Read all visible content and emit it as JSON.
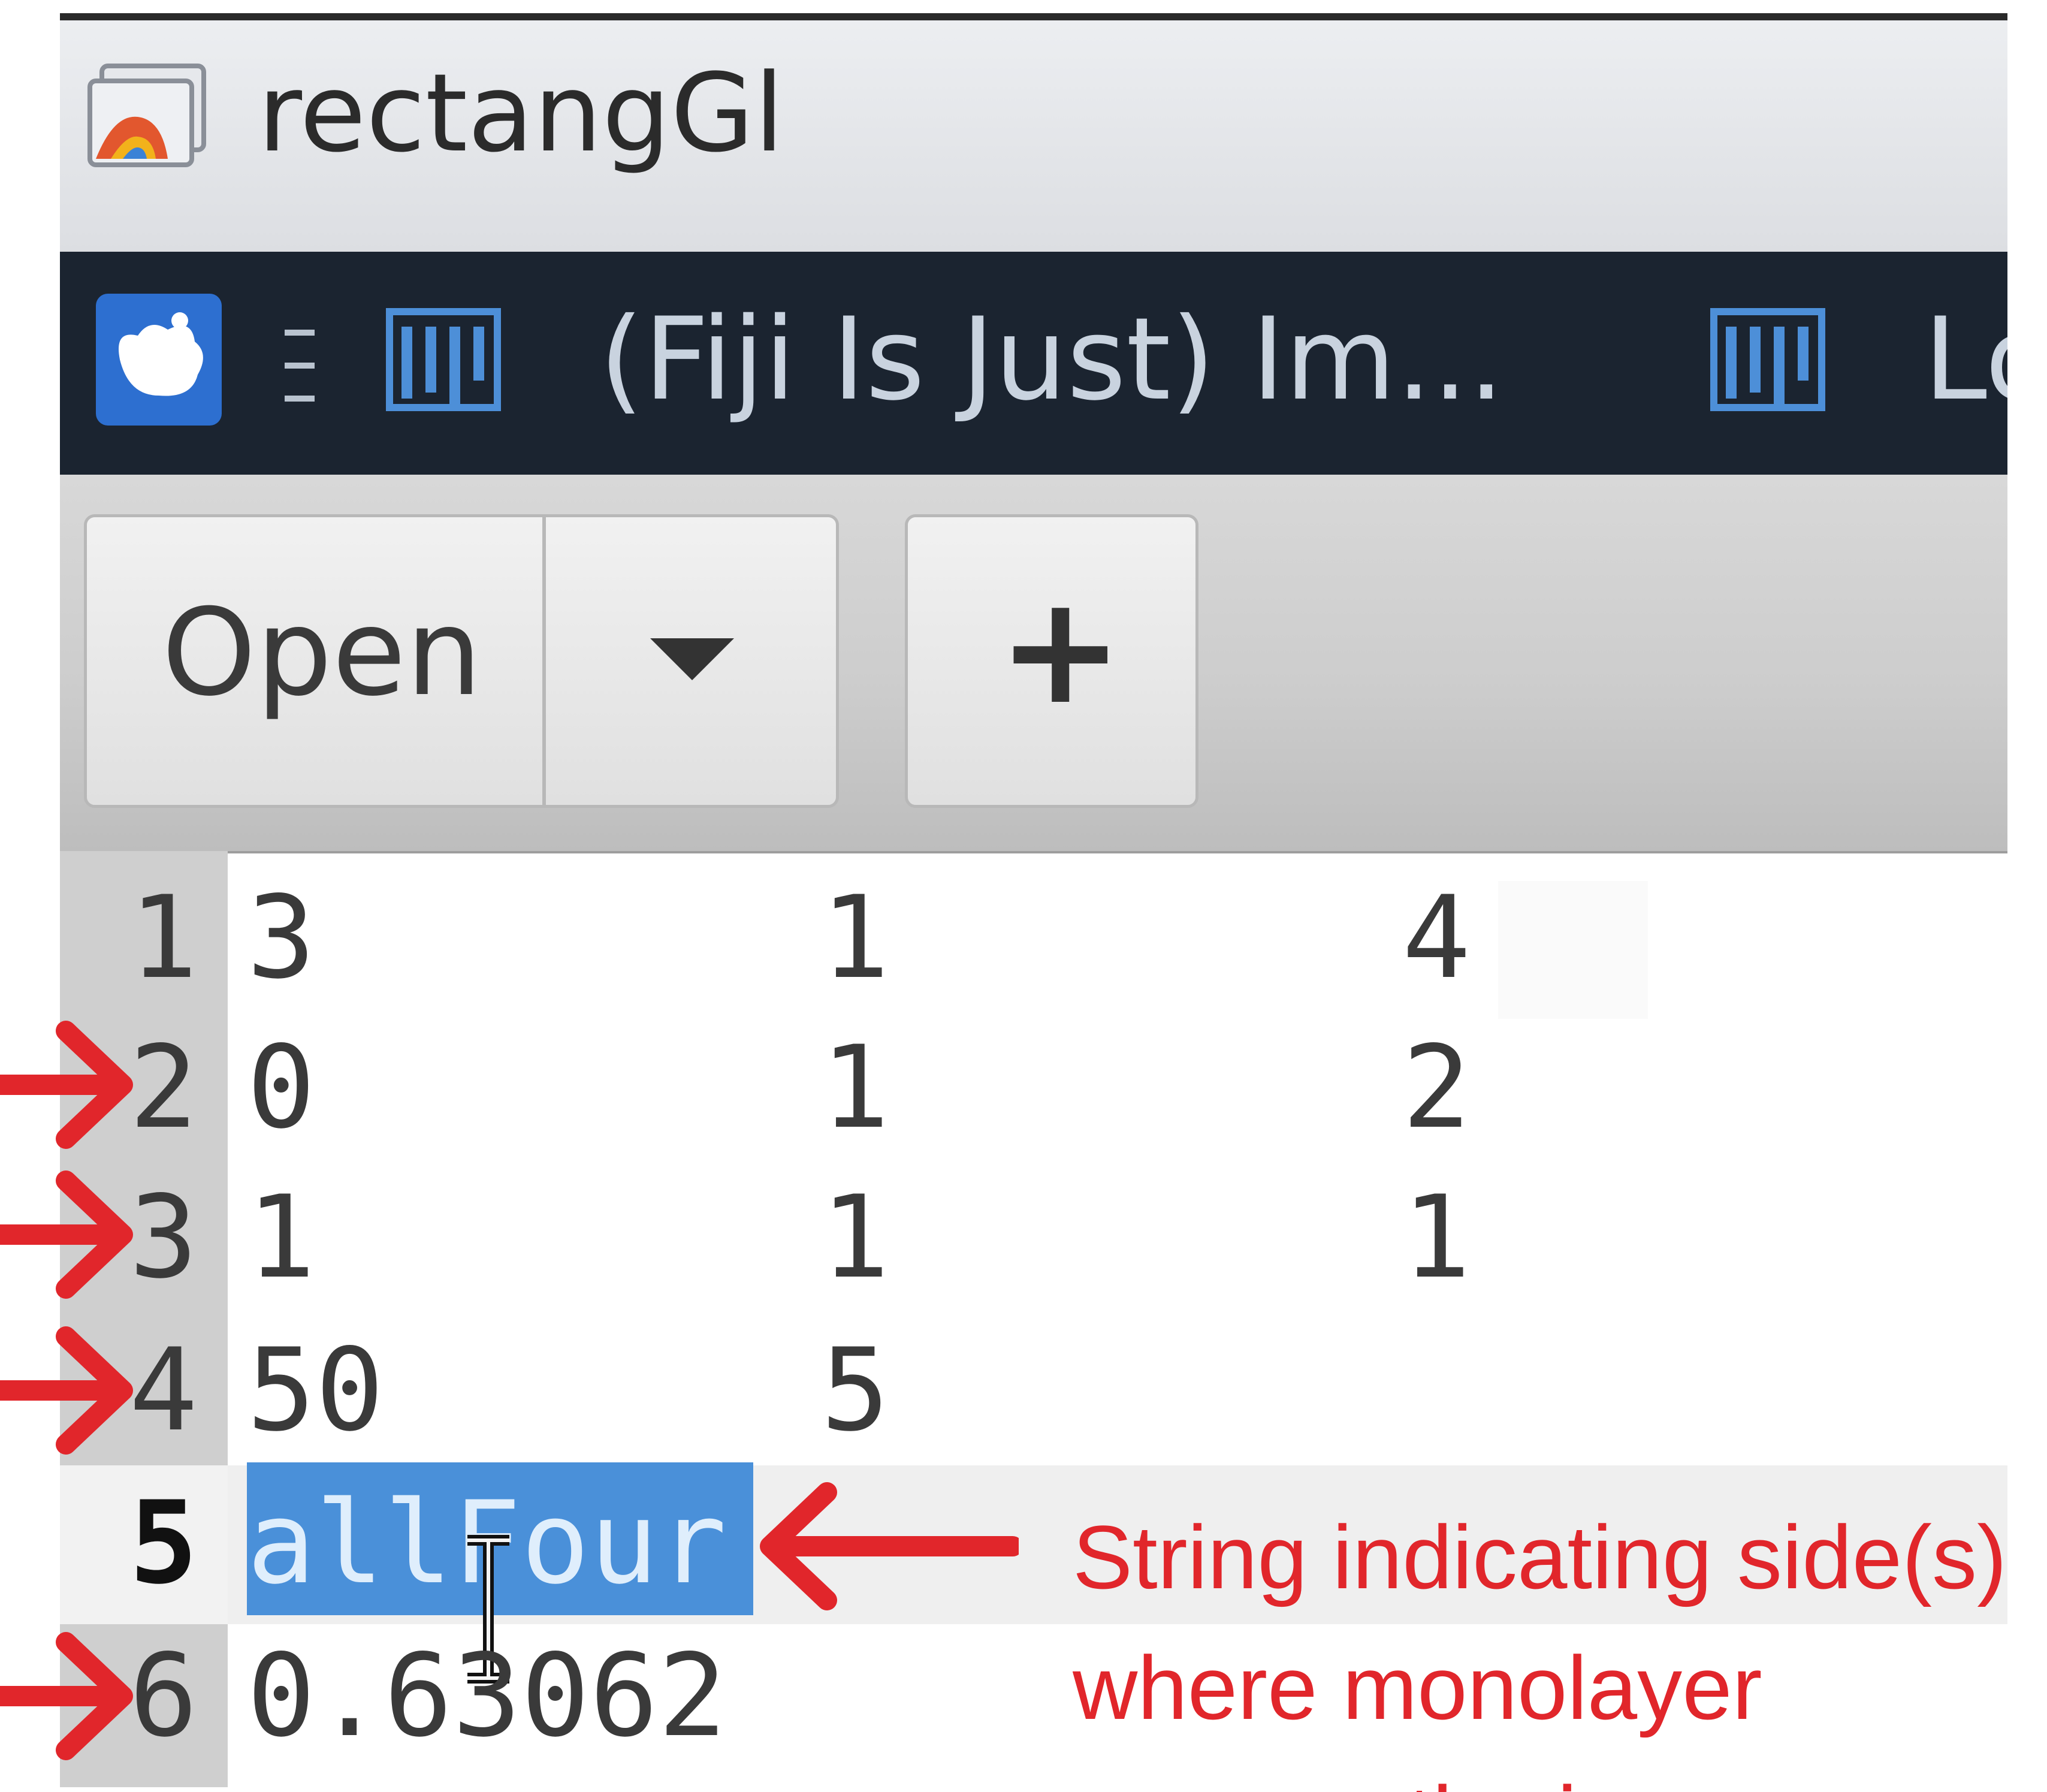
{
  "window": {
    "title": "rectangGl"
  },
  "taskbar": {
    "items": [
      {
        "label": "(Fiji Is Just) Im..."
      },
      {
        "label": "Lo"
      }
    ]
  },
  "toolbar": {
    "open_label": "Open",
    "new_label": "+"
  },
  "editor": {
    "lines": [
      {
        "number": "1",
        "cells": [
          "3",
          "1",
          "4"
        ]
      },
      {
        "number": "2",
        "cells": [
          "0",
          "1",
          "2"
        ]
      },
      {
        "number": "3",
        "cells": [
          "1",
          "1",
          "1"
        ]
      },
      {
        "number": "4",
        "cells": [
          "50",
          "5",
          ""
        ]
      },
      {
        "number": "5",
        "cells": [
          "allFour",
          "",
          ""
        ]
      },
      {
        "number": "6",
        "cells": [
          "0.63062",
          "",
          ""
        ]
      }
    ],
    "selected_text": "allFour"
  },
  "annotation": {
    "text": "String indicating side(s) where monolayer crosses the image",
    "color": "#e1262b"
  },
  "colors": {
    "selection": "#4a90d9",
    "taskbar_bg": "#1b2430",
    "arrow": "#e1262b"
  }
}
